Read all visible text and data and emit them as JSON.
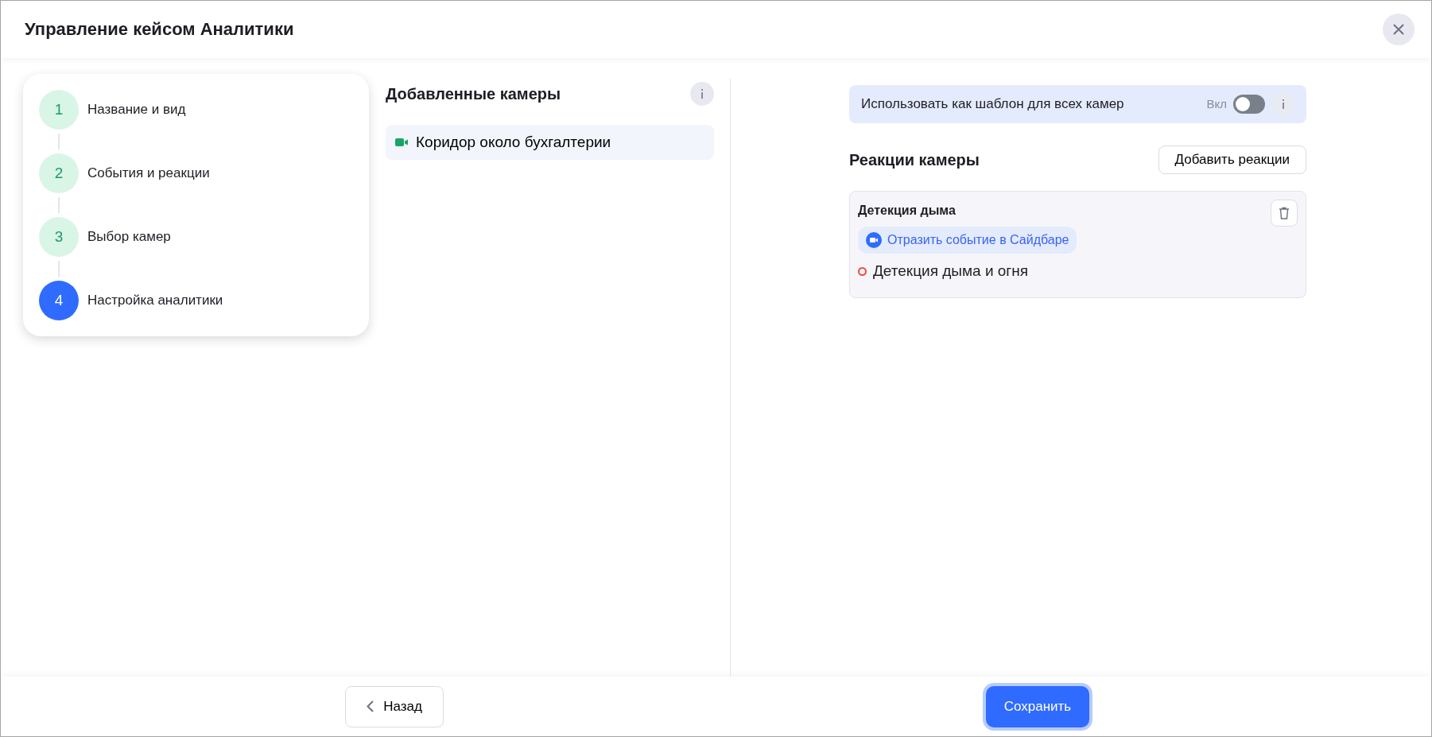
{
  "window": {
    "title": "Управление кейсом Аналитики"
  },
  "steps": [
    {
      "number": "1",
      "label": "Название и вид",
      "selected": false
    },
    {
      "number": "2",
      "label": "События и реакции",
      "selected": false
    },
    {
      "number": "3",
      "label": "Выбор камер",
      "selected": false
    },
    {
      "number": "4",
      "label": "Настройка аналитики",
      "selected": true
    }
  ],
  "cameras": {
    "title": "Добавленные камеры",
    "items": [
      {
        "name": "Коридор около бухгалтерии",
        "selected": true
      }
    ]
  },
  "template": {
    "label": "Использовать как шаблон для всех камер",
    "toggle_label": "Вкл",
    "on": false
  },
  "reactions": {
    "title": "Реакции камеры",
    "add_button": "Добавить реакции",
    "items": [
      {
        "title": "Детекция дыма",
        "action": "Отразить событие в Сайдбаре",
        "events": [
          {
            "name": "Детекция дыма и огня",
            "color": "#f0483e"
          }
        ]
      }
    ]
  },
  "footer": {
    "back": "Назад",
    "save": "Сохранить"
  }
}
